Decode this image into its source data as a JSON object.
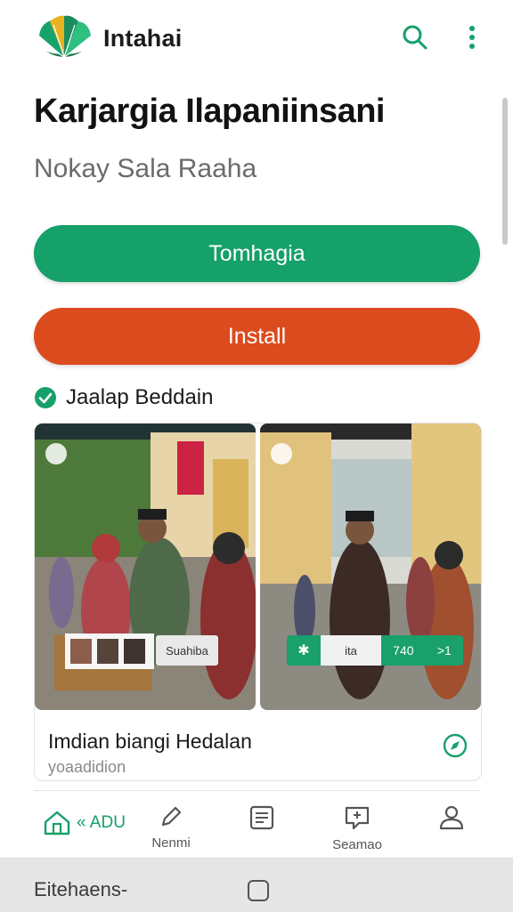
{
  "app": {
    "name": "Intahai"
  },
  "header": {
    "title": "Karjargia Ilapaniinsani",
    "subtitle": "Nokay Sala Raaha"
  },
  "actions": {
    "primary_label": "Tomhagia",
    "install_label": "Install"
  },
  "verified": {
    "label": "Jaalap Beddain"
  },
  "card": {
    "caption": "Imdian biangi Hedalan",
    "subcaption": "yoaadidion",
    "left_shot_label": "Suahiba",
    "right_shot_mid": "ita",
    "right_shot_value": "740",
    "right_shot_arrow": ">1"
  },
  "nav": {
    "home_label": "« ADU",
    "item2_label": "Nenmi",
    "item4_label": "Seamao"
  },
  "system": {
    "label": "Eitehaens-"
  },
  "colors": {
    "primary": "#16a06a",
    "install": "#dc4b1e",
    "nav_active": "#16a06a"
  },
  "icons": [
    "logo-icon",
    "search-icon",
    "more-vert-icon",
    "check-circle-icon",
    "compass-icon",
    "home-icon",
    "pen-icon",
    "document-icon",
    "chat-icon",
    "person-icon"
  ]
}
